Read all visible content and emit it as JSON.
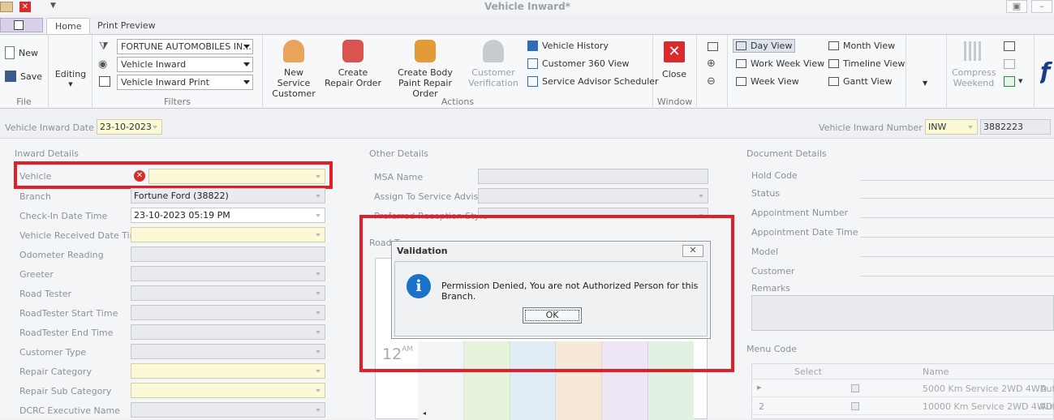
{
  "window": {
    "title": "Vehicle Inward*"
  },
  "ribbon_tabs": [
    {
      "label": "Home"
    },
    {
      "label": "Print Preview"
    }
  ],
  "file_group": {
    "label": "File",
    "new_label": "New",
    "save_label": "Save"
  },
  "editing": {
    "label": "Editing"
  },
  "filters": {
    "label": "Filters",
    "dealer": "FORTUNE AUTOMOBILES IN...",
    "view": "Vehicle Inward",
    "print": "Vehicle Inward Print"
  },
  "actions": {
    "label": "Actions",
    "new_service_customer": [
      "New Service",
      "Customer"
    ],
    "create_repair_order": [
      "Create",
      "Repair Order"
    ],
    "create_body_paint": [
      "Create Body",
      "Paint Repair Order"
    ],
    "customer_verification": [
      "Customer",
      "Verification"
    ],
    "vehicle_history": "Vehicle History",
    "customer_360": "Customer 360 View",
    "service_advisor_scheduler": "Service Advisor Scheduler"
  },
  "window_group": {
    "label": "Window",
    "close_label": "Close"
  },
  "views": {
    "day": "Day View",
    "work_week": "Work Week View",
    "week": "Week View",
    "month": "Month View",
    "timeline": "Timeline View",
    "gantt": "Gantt View",
    "compress_weekend": [
      "Compress",
      "Weekend"
    ]
  },
  "header_fields": {
    "inward_date_label": "Vehicle Inward Date",
    "inward_date_value": "23-10-2023",
    "inward_number_label": "Vehicle Inward Number",
    "inward_number_prefix": "INW",
    "inward_number_value": "3882223"
  },
  "inward_details": {
    "section": "Inward Details",
    "vehicle": "Vehicle",
    "branch": "Branch",
    "branch_value": "Fortune Ford (38822)",
    "checkin": "Check-In Date Time",
    "checkin_value": "23-10-2023 05:19 PM",
    "received": "Vehicle Received Date  Time",
    "odometer": "Odometer Reading",
    "greeter": "Greeter",
    "road_tester": "Road Tester",
    "rt_start": "RoadTester Start Time",
    "rt_end": "RoadTester End Time",
    "customer_type": "Customer Type",
    "repair_category": "Repair Category",
    "repair_sub_category": "Repair Sub Category",
    "dcrc": "DCRC Executive Name"
  },
  "other_details": {
    "section": "Other Details",
    "msa": "MSA Name",
    "assign": "Assign To Service Advisor",
    "preferred": "Preferred Reception Style",
    "road_test": "Road Test Schedule",
    "time_label": "12",
    "time_suffix": "AM"
  },
  "document_details": {
    "section": "Document Details",
    "hold_code": "Hold Code",
    "status": "Status",
    "appt_number": "Appointment Number",
    "appt_datetime": "Appointment Date Time",
    "model": "Model",
    "customer": "Customer",
    "remarks": "Remarks"
  },
  "menu_code": {
    "section": "Menu Code",
    "col_select": "Select",
    "col_name": "Name",
    "rows": [
      {
        "num": "",
        "name": "5000 Km Service 2WD 4WD",
        "extra": "Aut"
      },
      {
        "num": "2",
        "name": "10000 Km Service 2WD 4WD",
        "extra": "Aut"
      }
    ]
  },
  "dialog": {
    "title": "Validation",
    "message": "Permission Denied, You are not Authorized Person for this Branch.",
    "ok": "OK"
  },
  "colors": {
    "highlight": "#e01f28",
    "info_icon": "#1a73c8",
    "accent_red": "#d92b2b"
  }
}
